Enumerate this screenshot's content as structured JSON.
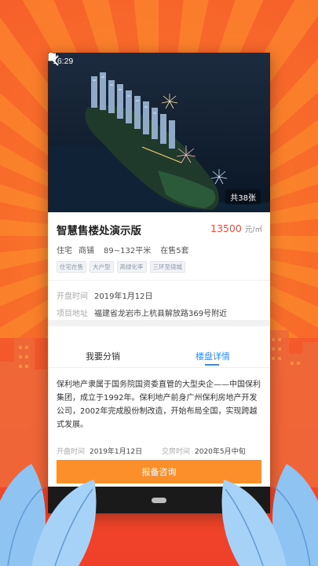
{
  "status_bar": {
    "time": "16:29"
  },
  "hero": {
    "photo_count": "共38张"
  },
  "project": {
    "title": "智慧售楼处演示版",
    "price": "13500",
    "price_unit": "元/㎡",
    "types": [
      "住宅",
      "商铺"
    ],
    "area_range": "89~132平米",
    "on_sale": "在售5套",
    "tags": [
      "住宅在售",
      "大户型",
      "高绿化率",
      "三环至绕城"
    ]
  },
  "fields": {
    "open_time_label": "开盘时间",
    "open_time_value": "2019年1月12日",
    "address_label": "项目地址",
    "address_value": "福建省龙岩市上杭县解放路369号附近"
  },
  "tabs": {
    "left": "我要分销",
    "right": "楼盘详情"
  },
  "details": {
    "description": "保利地产隶属于国务院国资委直管的大型央企——中国保利集团，成立于1992年。保利地产前身广州保利房地产开发公司，2002年完成股份制改造，开始布局全国，实现跨越式发展。",
    "open_time_label": "开盘时间",
    "open_time_value": "2019年1月12日",
    "delivery_label": "交房时间",
    "delivery_value": "2020年5月中旬"
  },
  "cta": {
    "label": "报备咨询"
  },
  "colors": {
    "accent_blue": "#2f8cff",
    "price_red": "#f04b3a",
    "cta_orange": "#fc8f2a",
    "background_orange": "#f6602a"
  }
}
